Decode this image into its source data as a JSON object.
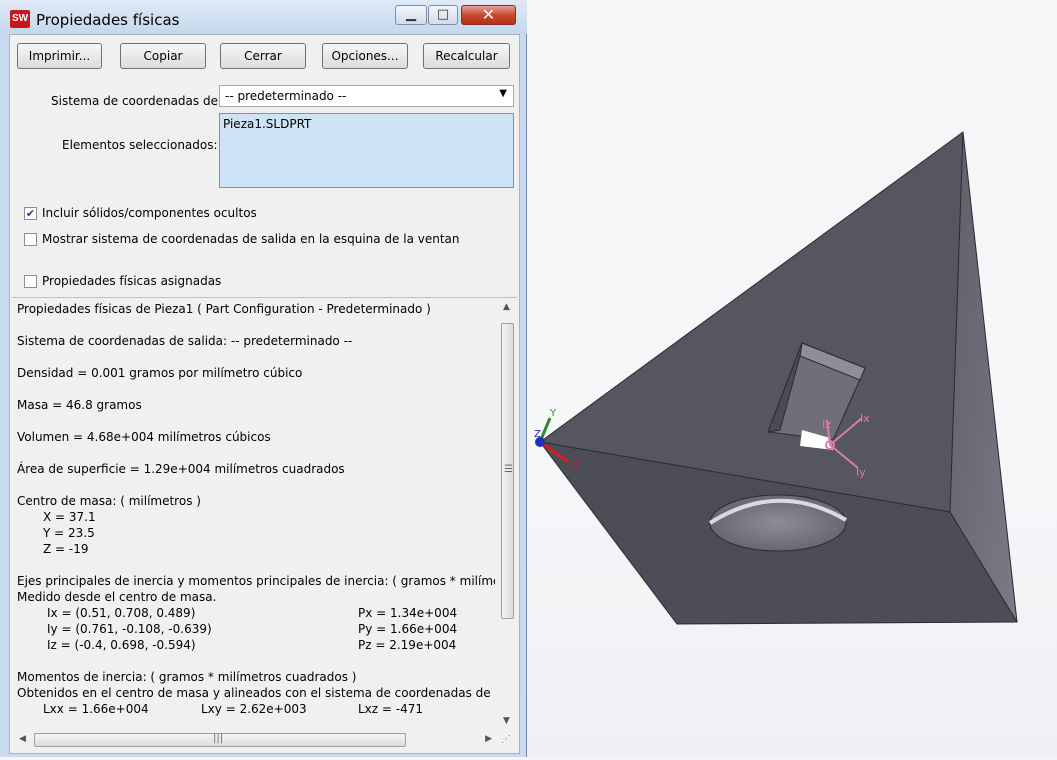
{
  "window": {
    "title": "Propiedades físicas",
    "icon_label": "SW",
    "min_glyph": "▁",
    "max_glyph": "□",
    "close_glyph": "✕"
  },
  "toolbar": {
    "print_label": "Imprimir...",
    "copy_label": "Copiar",
    "close_label": "Cerrar",
    "options_label": "Opciones...",
    "recalc_label": "Recalcular"
  },
  "form": {
    "coord_label": "Sistema de coordenadas de",
    "coord_value": "-- predeterminado --",
    "selected_label": "Elementos seleccionados:",
    "selected_items": [
      "Pieza1.SLDPRT"
    ],
    "include_hidden_label": "Incluir sólidos/componentes ocultos",
    "include_hidden_checked": true,
    "show_coord_label": "Mostrar sistema de coordenadas de salida en la esquina de la ventan",
    "show_coord_checked": false,
    "assigned_label": "Propiedades físicas asignadas",
    "assigned_checked": false
  },
  "results": {
    "header": "Propiedades físicas de Pieza1 ( Part Configuration - Predeterminado )",
    "output_coord": "Sistema de coordenadas de salida: -- predeterminado --",
    "density": "Densidad = 0.001 gramos por  milímetro cúbico",
    "mass": "Masa = 46.8 gramos",
    "volume": "Volumen = 4.68e+004  milímetros cúbicos",
    "surface": "Área de superficie = 1.29e+004  milímetros cuadrados",
    "center_title": "Centro de masa: ( milímetros )",
    "cx": "X = 37.1",
    "cy": "Y = 23.5",
    "cz": "Z = -19",
    "axes_title": "Ejes principales de inercia y momentos principales de inercia: ( gramos *  milímetr",
    "axes_sub": "Medido desde el centro de masa.",
    "ix": "Ix = (0.51, 0.708, 0.489)",
    "iy": "Iy = (0.761, -0.108, -0.639)",
    "iz": "Iz = (-0.4, 0.698, -0.594)",
    "px": "Px = 1.34e+004",
    "py": "Py = 1.66e+004",
    "pz": "Pz = 2.19e+004",
    "moments_title": "Momentos de inercia: ( gramos *  milímetros cuadrados )",
    "moments_sub": "Obtenidos en el centro de masa y alineados con el sistema de coordenadas de resu",
    "lxx": "Lxx = 1.66e+004",
    "lxy": "Lxy = 2.62e+003",
    "lxz": "Lxz = -471"
  },
  "scrollbars": {
    "up": "▲",
    "down": "▼",
    "left": "◀",
    "right": "▶",
    "grip_v": "☰",
    "grip_h": "|||",
    "resize": "⋰"
  },
  "viewport": {
    "triad_labels": {
      "x": "X",
      "y": "Y",
      "z": "Z"
    },
    "principal_labels": {
      "ix": "Ix",
      "iy": "Iy",
      "iz": "Iz"
    },
    "colors": {
      "face_top": "#55565f",
      "face_side": "#6b6c76",
      "triad_x": "#d81e1e",
      "triad_y": "#2e8b2e",
      "triad_z": "#1f2fb8",
      "principal": "#e07aa8"
    }
  }
}
